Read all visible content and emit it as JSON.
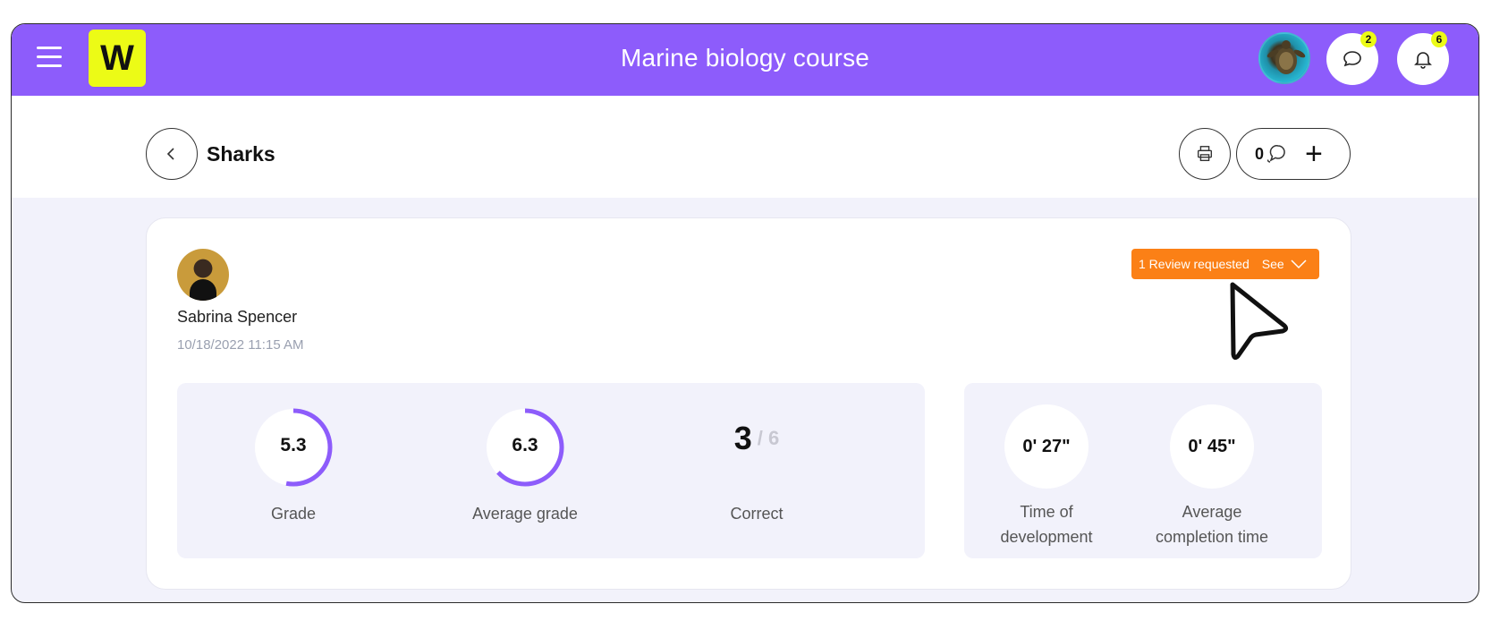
{
  "header": {
    "app_title": "Marine biology course",
    "logo_letter": "W",
    "messages_badge": "2",
    "notifications_badge": "6"
  },
  "page": {
    "title": "Sharks",
    "comment_count": "0"
  },
  "submission": {
    "student_name": "Sabrina Spencer",
    "date": "10/18/2022 11:15 AM",
    "review": {
      "count_label": "1 Review requested",
      "see_label": "See"
    }
  },
  "stats": {
    "grade": {
      "value": "5.3",
      "label": "Grade",
      "fraction": 0.53
    },
    "average_grade": {
      "value": "6.3",
      "label": "Average grade",
      "fraction": 0.63
    },
    "correct": {
      "value": "3",
      "total": "/ 6",
      "label": "Correct"
    },
    "time_of_development": {
      "value": "0' 27\"",
      "label_line1": "Time of",
      "label_line2": "development"
    },
    "average_completion_time": {
      "value": "0' 45\"",
      "label_line1": "Average",
      "label_line2": "completion time"
    }
  },
  "colors": {
    "brand_purple": "#8d5cfb",
    "logo_yellow": "#ecfb16",
    "review_orange": "#fb8016",
    "ring_purple": "#8d5cfb"
  },
  "icons": [
    "menu-icon",
    "chevron-left-icon",
    "print-icon",
    "comment-icon",
    "plus-icon",
    "chat-icon",
    "bell-icon",
    "chevron-down-icon",
    "cursor-icon"
  ]
}
